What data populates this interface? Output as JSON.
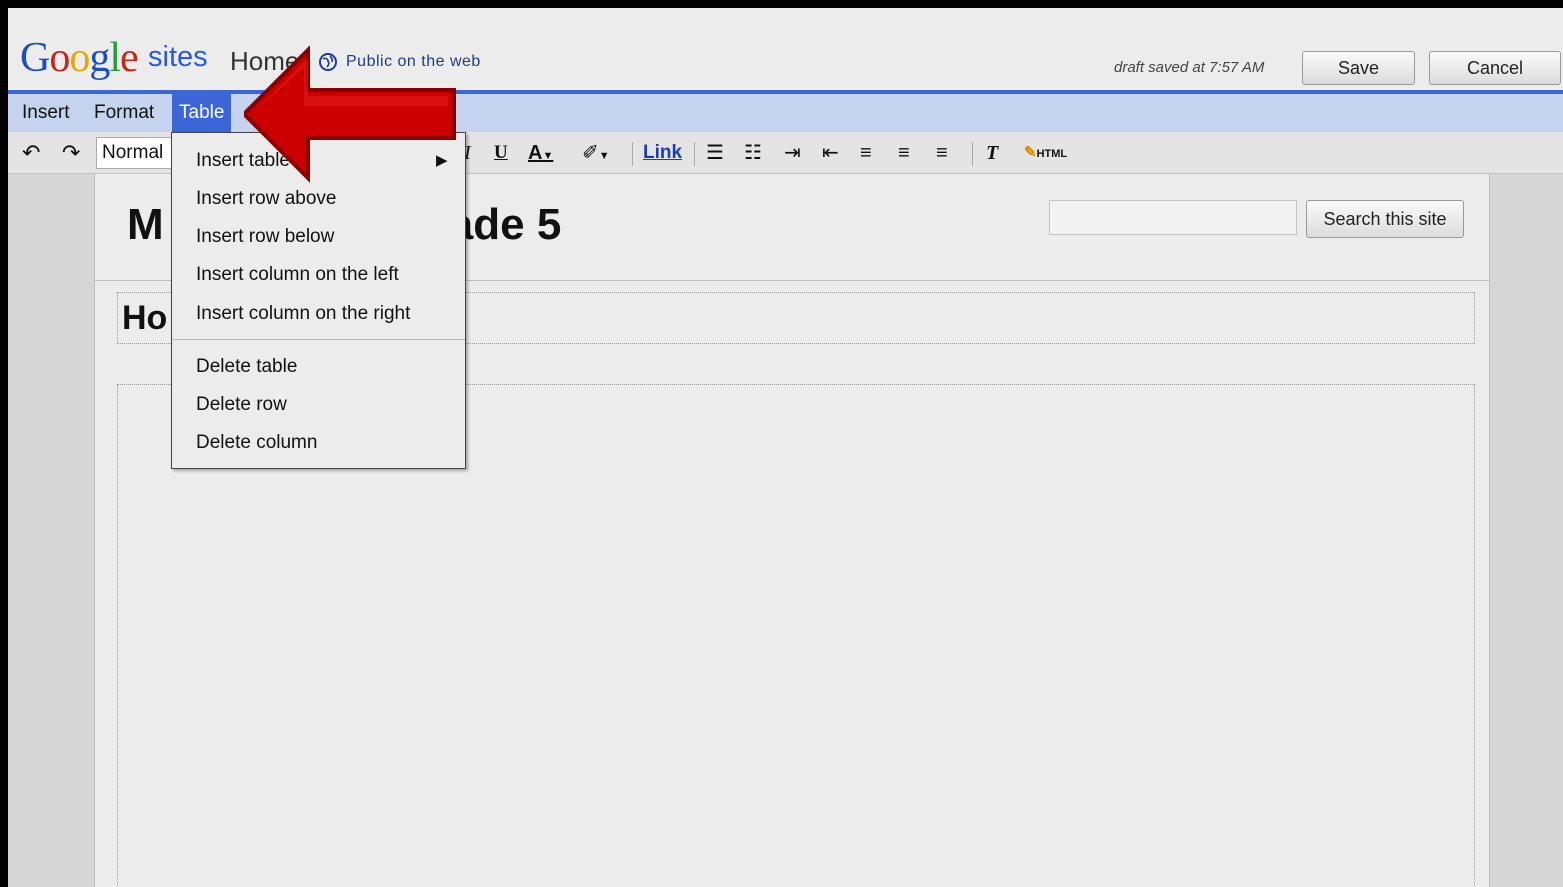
{
  "header": {
    "logo_text": "Google",
    "product": "sites",
    "page_name": "Home",
    "visibility": "Public on the web",
    "draft_status": "draft saved at 7:57 AM",
    "save_label": "Save",
    "cancel_label": "Cancel"
  },
  "menubar": {
    "items": [
      {
        "label": "Insert"
      },
      {
        "label": "Format"
      },
      {
        "label": "Table",
        "active": true
      }
    ]
  },
  "toolbar": {
    "paragraph_style": "Normal",
    "italic_glyph": "I",
    "underline_glyph": "U",
    "text_color_glyph": "A",
    "link_label": "Link",
    "clear_format_glyph": "T",
    "html_label": "HTML"
  },
  "dropdown": {
    "items": [
      {
        "label": "Insert table",
        "has_submenu": true
      },
      {
        "label": "Insert row above"
      },
      {
        "label": "Insert row below"
      },
      {
        "label": "Insert column on the left"
      },
      {
        "label": "Insert column on the right"
      },
      {
        "label": "Delete table"
      },
      {
        "label": "Delete row"
      },
      {
        "label": "Delete column"
      }
    ]
  },
  "page": {
    "site_title": "Mr. ... Grade 5",
    "site_title_visible_left": "M",
    "site_title_visible_right": "rade 5",
    "page_heading": "Ho",
    "search_button": "Search this site",
    "search_value": ""
  },
  "colors": {
    "accent_blue": "#3c66d6",
    "menubar_bg": "#c6d3ef",
    "arrow_red": "#cc0000"
  }
}
